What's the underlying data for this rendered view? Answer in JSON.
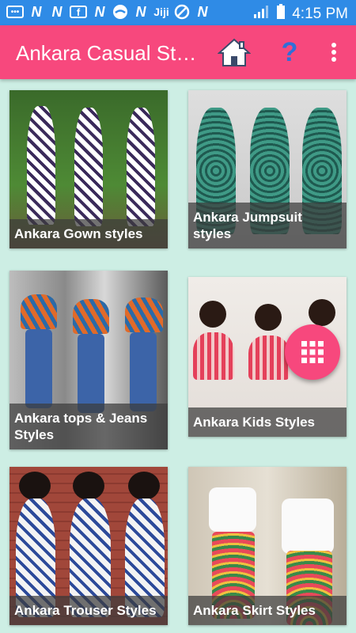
{
  "status_bar": {
    "time": "4:15 PM",
    "notification_icons": [
      "chat-icon",
      "n-icon",
      "n-icon",
      "facebook-icon",
      "n-icon",
      "download-icon",
      "n-icon",
      "jiji-icon",
      "no-entry-icon",
      "n-icon"
    ],
    "jiji_text": "Jiji",
    "background_color": "#2f8be6"
  },
  "app_bar": {
    "title": "Ankara Casual Styles",
    "background_color": "#f7487d",
    "help_symbol": "?"
  },
  "grid": {
    "items": [
      {
        "label": "Ankara Gown styles"
      },
      {
        "label": "Ankara Jumpsuit styles"
      },
      {
        "label": "Ankara tops & Jeans Styles"
      },
      {
        "label": "Ankara Kids Styles"
      },
      {
        "label": "Ankara Trouser Styles"
      },
      {
        "label": "Ankara Skirt Styles"
      }
    ]
  },
  "page_background": "#cdeee4"
}
